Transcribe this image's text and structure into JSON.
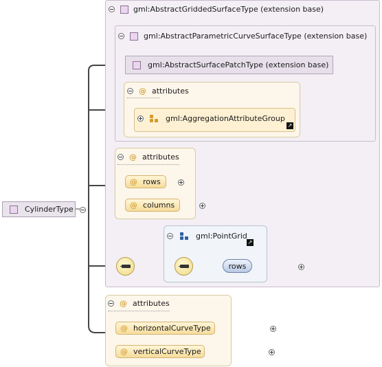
{
  "root": {
    "label": "CylinderType"
  },
  "extension_outer": {
    "label": "gml:AbstractGriddedSurfaceType (extension base)"
  },
  "extension_inner": {
    "label": "gml:AbstractParametricCurveSurfaceType (extension base)"
  },
  "extension_innermost": {
    "label": "gml:AbstractSurfacePatchType (extension base)"
  },
  "attributes_inner": {
    "label": "attributes",
    "group": "gml:AggregationAttributeGroup"
  },
  "attributes_grid": {
    "label": "attributes",
    "items": [
      "rows",
      "columns"
    ]
  },
  "sequence": {
    "pointgrid": {
      "label": "gml:PointGrid"
    },
    "rows": {
      "label": "rows"
    }
  },
  "attributes_outer": {
    "label": "attributes",
    "items": [
      "horizontalCurveType",
      "verticalCurveType"
    ]
  },
  "colors": {
    "extension_bg": "#f3eff5",
    "attribute_bg": "#fdf6ea",
    "pill": "#f6dc9b",
    "element_pill": "#b9c9e4"
  },
  "icons": [
    "minus-toggle-icon",
    "plus-toggle-icon",
    "complex-type-icon",
    "attribute-icon",
    "attribute-group-icon",
    "element-reference-icon",
    "sequence-icon",
    "link-arrow-icon"
  ]
}
